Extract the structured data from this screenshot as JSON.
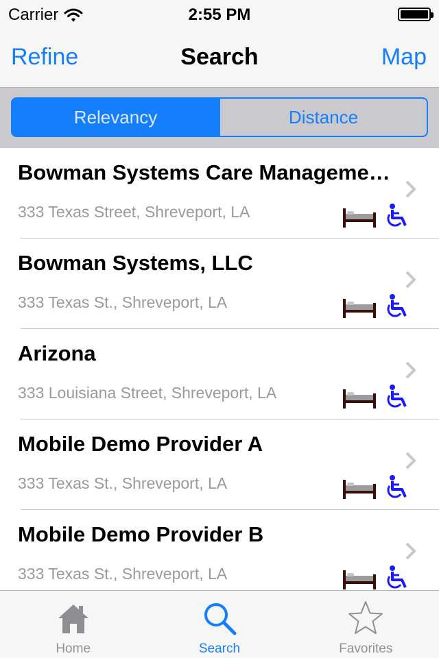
{
  "status_bar": {
    "carrier": "Carrier",
    "time": "2:55 PM",
    "wifi_icon": "wifi-icon",
    "battery_icon": "battery-icon"
  },
  "nav_bar": {
    "left_button": "Refine",
    "title": "Search",
    "right_button": "Map"
  },
  "segmented_control": {
    "options": [
      "Relevancy",
      "Distance"
    ],
    "selected": "Relevancy"
  },
  "results": [
    {
      "name": "Bowman Systems Care Manageme…",
      "address": "333 Texas Street, Shreveport, LA",
      "icons": [
        "bed-icon",
        "wheelchair-icon",
        "chevron-right-icon"
      ]
    },
    {
      "name": "Bowman Systems, LLC",
      "address": "333 Texas St., Shreveport, LA",
      "icons": [
        "bed-icon",
        "wheelchair-icon",
        "chevron-right-icon"
      ]
    },
    {
      "name": "Arizona",
      "address": "333 Louisiana Street, Shreveport, LA",
      "icons": [
        "bed-icon",
        "wheelchair-icon",
        "chevron-right-icon"
      ]
    },
    {
      "name": "Mobile Demo Provider A",
      "address": "333 Texas St., Shreveport, LA",
      "icons": [
        "bed-icon",
        "wheelchair-icon",
        "chevron-right-icon"
      ]
    },
    {
      "name": "Mobile Demo Provider B",
      "address": "333 Texas St., Shreveport, LA",
      "icons": [
        "bed-icon",
        "wheelchair-icon",
        "chevron-right-icon"
      ]
    }
  ],
  "tab_bar": {
    "tabs": [
      {
        "label": "Home",
        "icon": "home-icon",
        "active": false
      },
      {
        "label": "Search",
        "icon": "search-icon",
        "active": true
      },
      {
        "label": "Favorites",
        "icon": "star-icon",
        "active": false
      }
    ]
  },
  "colors": {
    "accent": "#157efb",
    "bar_background": "#f6f6f7",
    "segment_background": "#c9c9ce",
    "secondary_text": "#9a9a9a",
    "bed_frame": "#3a0f0a",
    "wheelchair": "#1a1aff"
  }
}
